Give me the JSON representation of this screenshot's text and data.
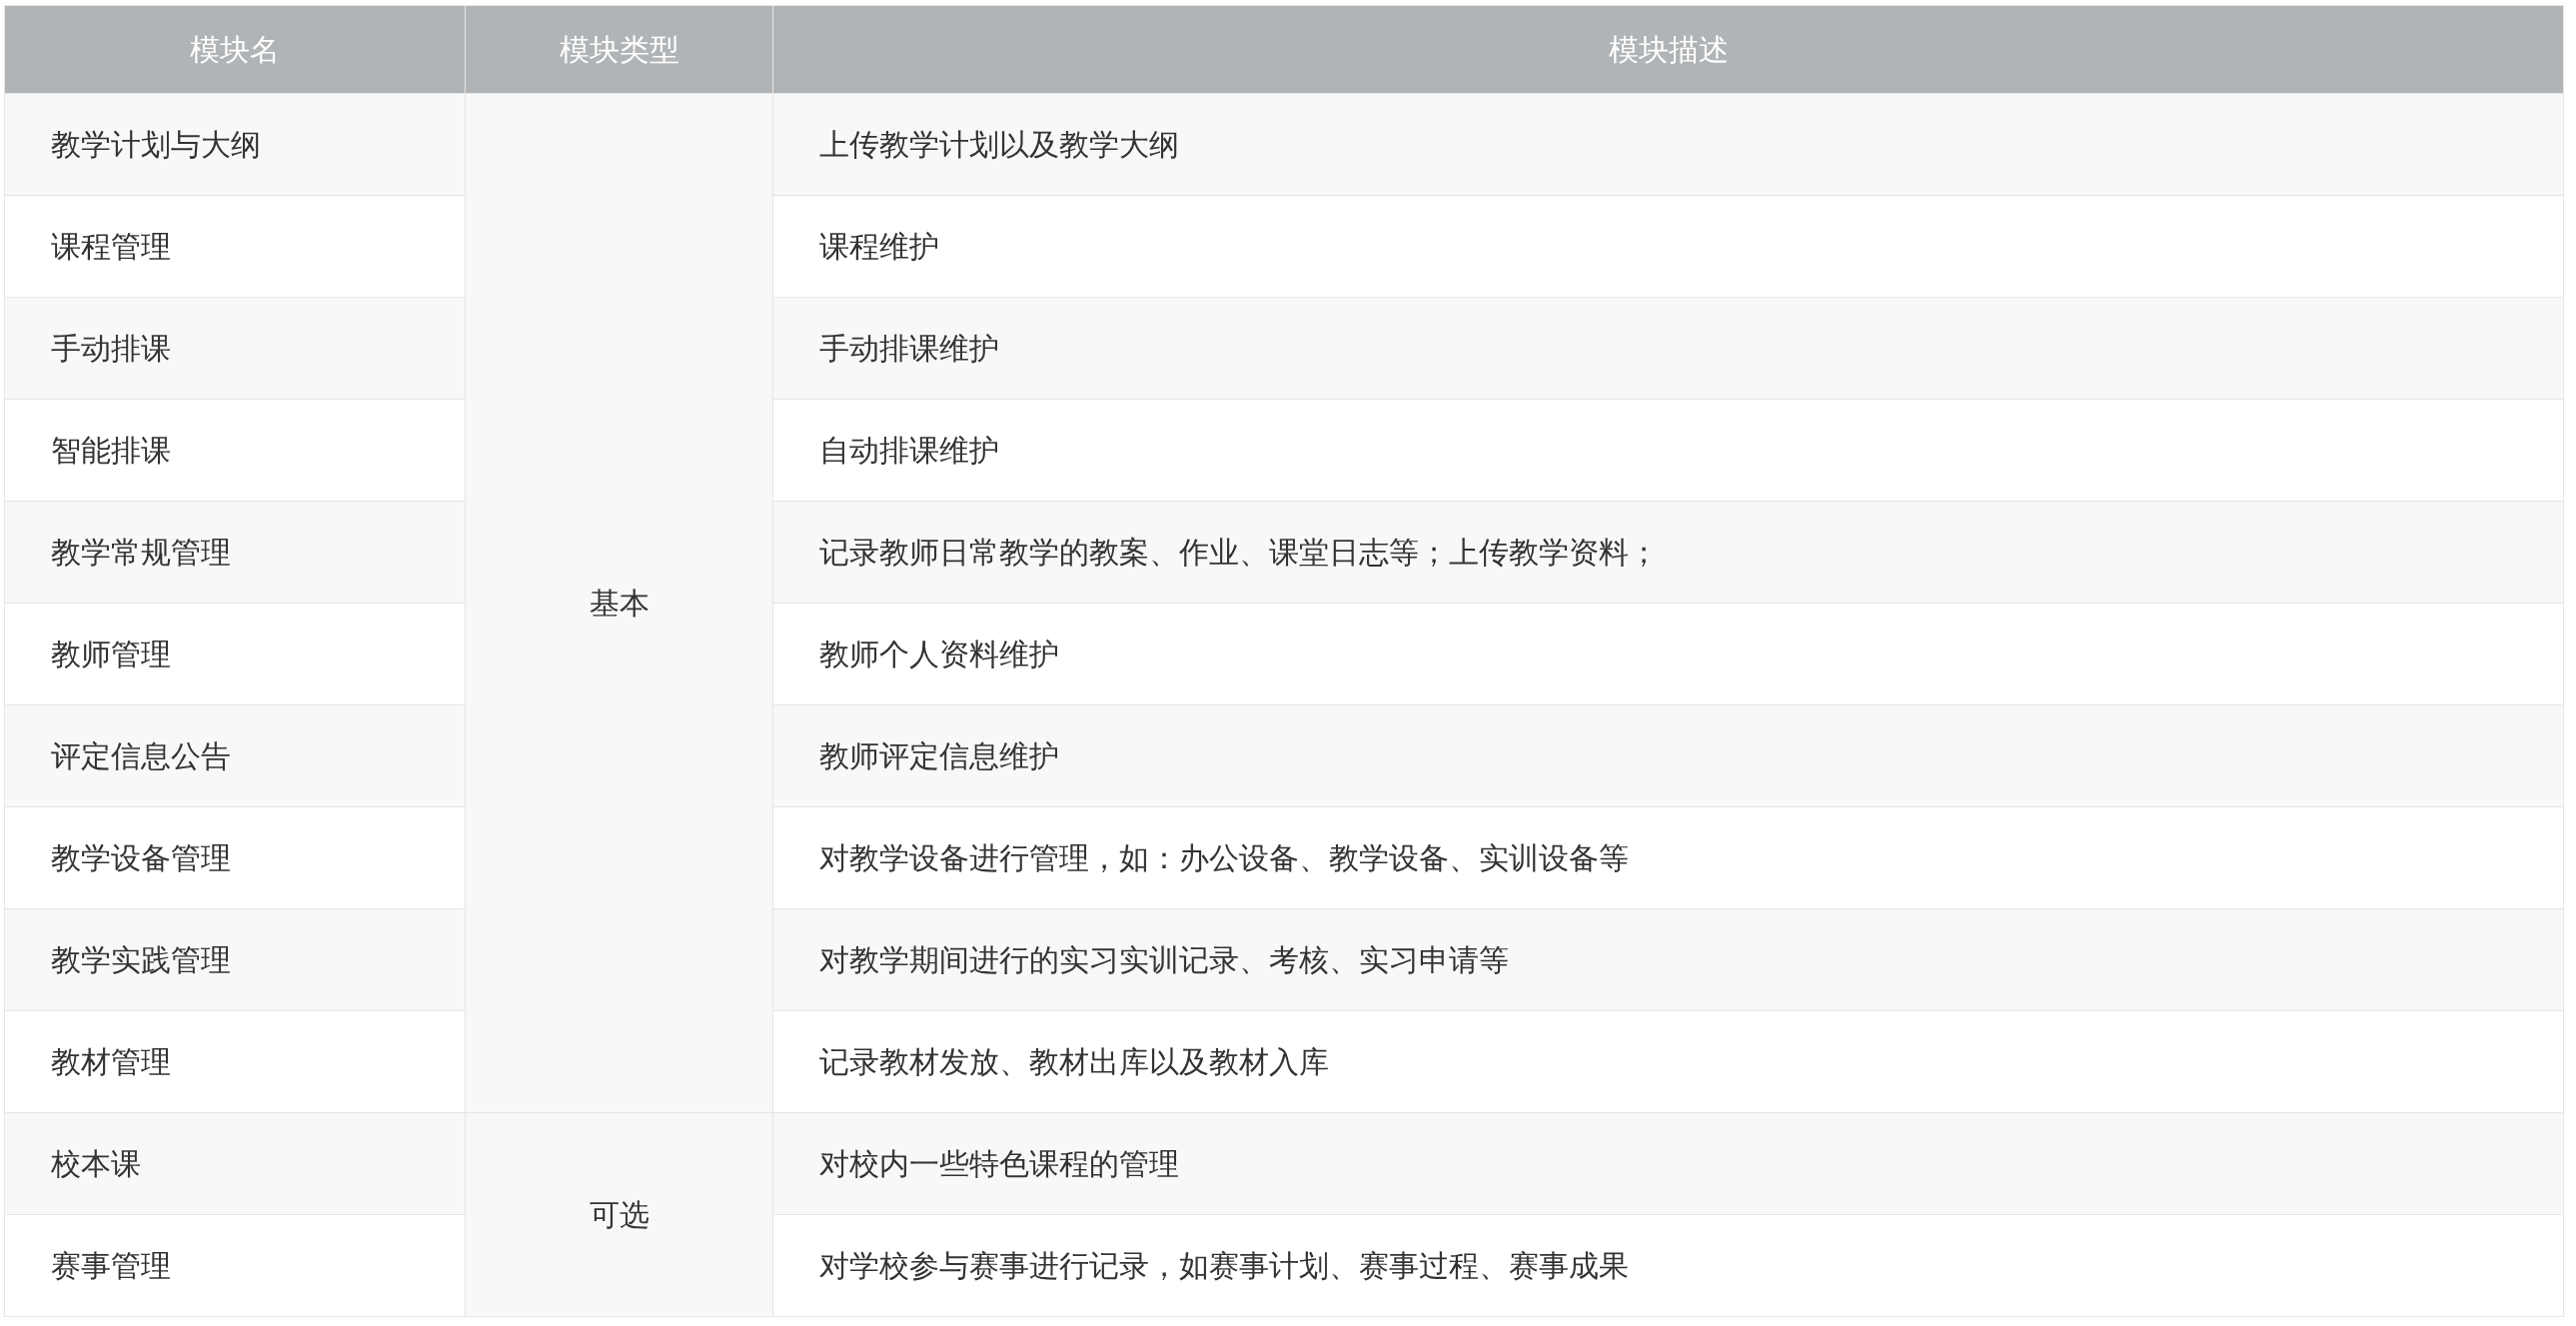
{
  "table": {
    "columns": [
      "模块名",
      "模块类型",
      "模块描述"
    ],
    "groups": [
      {
        "type": "基本",
        "rows": [
          {
            "name": "教学计划与大纲",
            "description": "上传教学计划以及教学大纲"
          },
          {
            "name": "课程管理",
            "description": "课程维护"
          },
          {
            "name": "手动排课",
            "description": "手动排课维护"
          },
          {
            "name": "智能排课",
            "description": "自动排课维护"
          },
          {
            "name": "教学常规管理",
            "description": "记录教师日常教学的教案、作业、课堂日志等；上传教学资料；"
          },
          {
            "name": "教师管理",
            "description": "教师个人资料维护"
          },
          {
            "name": "评定信息公告",
            "description": "教师评定信息维护"
          },
          {
            "name": "教学设备管理",
            "description": "对教学设备进行管理，如：办公设备、教学设备、实训设备等"
          },
          {
            "name": "教学实践管理",
            "description": "对教学期间进行的实习实训记录、考核、实习申请等"
          },
          {
            "name": "教材管理",
            "description": "记录教材发放、教材出库以及教材入库"
          }
        ]
      },
      {
        "type": "可选",
        "rows": [
          {
            "name": "校本课",
            "description": "对校内一些特色课程的管理"
          },
          {
            "name": "赛事管理",
            "description": "对学校参与赛事进行记录，如赛事计划、赛事过程、赛事成果"
          }
        ]
      }
    ]
  }
}
